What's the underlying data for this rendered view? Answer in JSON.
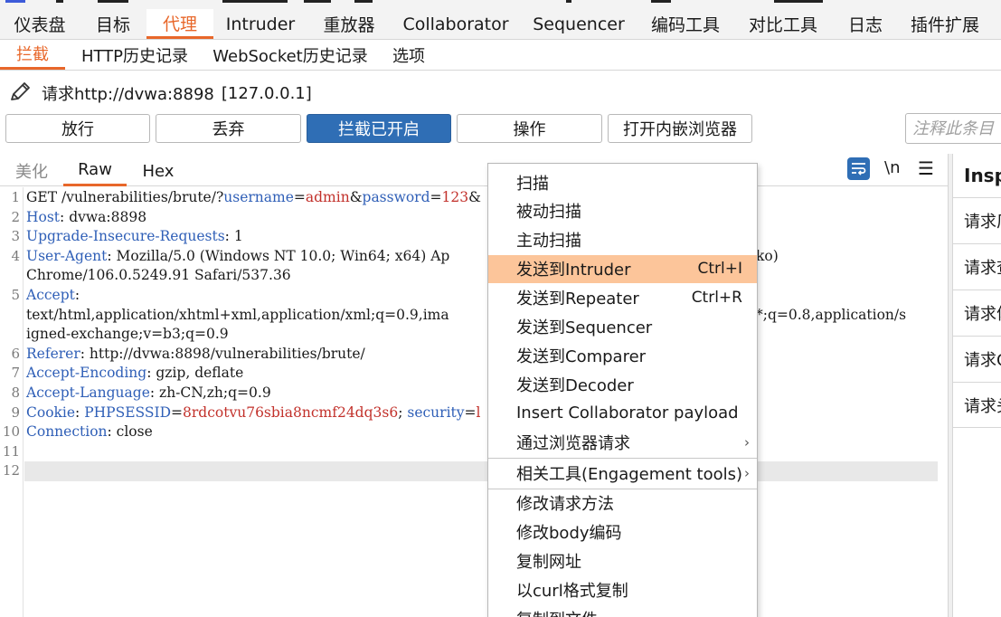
{
  "main_tabs": [
    {
      "label": "仪表盘",
      "active": false
    },
    {
      "label": "目标",
      "active": false
    },
    {
      "label": "代理",
      "active": true
    },
    {
      "label": "Intruder",
      "active": false
    },
    {
      "label": "重放器",
      "active": false
    },
    {
      "label": "Collaborator",
      "active": false
    },
    {
      "label": "Sequencer",
      "active": false
    },
    {
      "label": "编码工具",
      "active": false
    },
    {
      "label": "对比工具",
      "active": false
    },
    {
      "label": "日志",
      "active": false
    },
    {
      "label": "插件扩展",
      "active": false
    }
  ],
  "sub_tabs": [
    {
      "label": "拦截",
      "active": true
    },
    {
      "label": "HTTP历史记录",
      "active": false
    },
    {
      "label": "WebSocket历史记录",
      "active": false
    },
    {
      "label": "选项",
      "active": false
    }
  ],
  "request": {
    "label": "请求http://dvwa:8898",
    "ip": "[127.0.0.1]"
  },
  "buttons": {
    "forward": "放行",
    "drop": "丢弃",
    "intercept": "拦截已开启",
    "action": "操作",
    "browser": "打开内嵌浏览器"
  },
  "comment": {
    "placeholder": "注释此条目"
  },
  "editor_tabs": {
    "pretty": "美化",
    "raw": "Raw",
    "hex": "Hex",
    "newline_toggle": "\\n"
  },
  "code_lines": [
    {
      "n": "1",
      "parts": [
        {
          "t": "GET /vulnerabilities/brute/?"
        },
        {
          "t": "username",
          "c": "p"
        },
        {
          "t": "="
        },
        {
          "t": "admin",
          "c": "v"
        },
        {
          "t": "&"
        },
        {
          "t": "password",
          "c": "p"
        },
        {
          "t": "="
        },
        {
          "t": "123",
          "c": "v"
        },
        {
          "t": "&"
        }
      ]
    },
    {
      "n": "2",
      "parts": [
        {
          "t": "Host",
          "c": "h"
        },
        {
          "t": ": dvwa:8898"
        }
      ]
    },
    {
      "n": "3",
      "parts": [
        {
          "t": "Upgrade-Insecure-Requests",
          "c": "h"
        },
        {
          "t": ": 1"
        }
      ]
    },
    {
      "n": "4",
      "parts": [
        {
          "t": "User-Agent",
          "c": "h"
        },
        {
          "t": ": Mozilla/5.0 (Windows NT 10.0; Win64; x64) Ap"
        }
      ]
    },
    {
      "n": "",
      "parts": [
        {
          "t": "Chrome/106.0.5249.91 Safari/537.36"
        }
      ]
    },
    {
      "n": "5",
      "parts": [
        {
          "t": "Accept",
          "c": "h"
        },
        {
          "t": ":"
        }
      ]
    },
    {
      "n": "",
      "parts": [
        {
          "t": "text/html,application/xhtml+xml,application/xml;q=0.9,ima"
        }
      ]
    },
    {
      "n": "",
      "parts": [
        {
          "t": "igned-exchange;v=b3;q=0.9"
        }
      ]
    },
    {
      "n": "6",
      "parts": [
        {
          "t": "Referer",
          "c": "h"
        },
        {
          "t": ": http://dvwa:8898/vulnerabilities/brute/"
        }
      ]
    },
    {
      "n": "7",
      "parts": [
        {
          "t": "Accept-Encoding",
          "c": "h"
        },
        {
          "t": ": gzip, deflate"
        }
      ]
    },
    {
      "n": "8",
      "parts": [
        {
          "t": "Accept-Language",
          "c": "h"
        },
        {
          "t": ": zh-CN,zh;q=0.9"
        }
      ]
    },
    {
      "n": "9",
      "parts": [
        {
          "t": "Cookie",
          "c": "h"
        },
        {
          "t": ": "
        },
        {
          "t": "PHPSESSID",
          "c": "p"
        },
        {
          "t": "="
        },
        {
          "t": "8rdcotvu76sbia8ncmf24dq3s6",
          "c": "v"
        },
        {
          "t": "; "
        },
        {
          "t": "security",
          "c": "p"
        },
        {
          "t": "="
        },
        {
          "t": "l",
          "c": "v"
        }
      ]
    },
    {
      "n": "10",
      "parts": [
        {
          "t": "Connection",
          "c": "h"
        },
        {
          "t": ": close"
        }
      ]
    },
    {
      "n": "11",
      "parts": []
    },
    {
      "n": "12",
      "parts": []
    }
  ],
  "code_right_fragments": {
    "ua_tail": "ko)",
    "accept_tail": "*;q=0.8,application/s"
  },
  "inspector": {
    "title": "Insp",
    "rows": [
      "请求厂",
      "请求查",
      "请求体",
      "请求C",
      "请求头"
    ]
  },
  "context_menu": [
    {
      "label": "扫描"
    },
    {
      "label": "被动扫描"
    },
    {
      "label": "主动扫描"
    },
    {
      "label": "发送到Intruder",
      "shortcut": "Ctrl+I",
      "highlighted": true
    },
    {
      "label": "发送到Repeater",
      "shortcut": "Ctrl+R"
    },
    {
      "label": "发送到Sequencer"
    },
    {
      "label": "发送到Comparer"
    },
    {
      "label": "发送到Decoder"
    },
    {
      "label": "Insert Collaborator payload"
    },
    {
      "label": "通过浏览器请求",
      "submenu": true
    },
    {
      "label": "相关工具(Engagement tools)",
      "submenu": true,
      "separator_before": true
    },
    {
      "label": "修改请求方法",
      "separator_before": true
    },
    {
      "label": "修改body编码"
    },
    {
      "label": "复制网址"
    },
    {
      "label": "以curl格式复制"
    },
    {
      "label": "复制到文件"
    }
  ],
  "colors": {
    "accent": "#e8672a",
    "primary_button": "#2f6eb5",
    "menu_highlight": "#fcc59a",
    "header_key": "#2f5fb7",
    "param_value": "#c2312b"
  }
}
